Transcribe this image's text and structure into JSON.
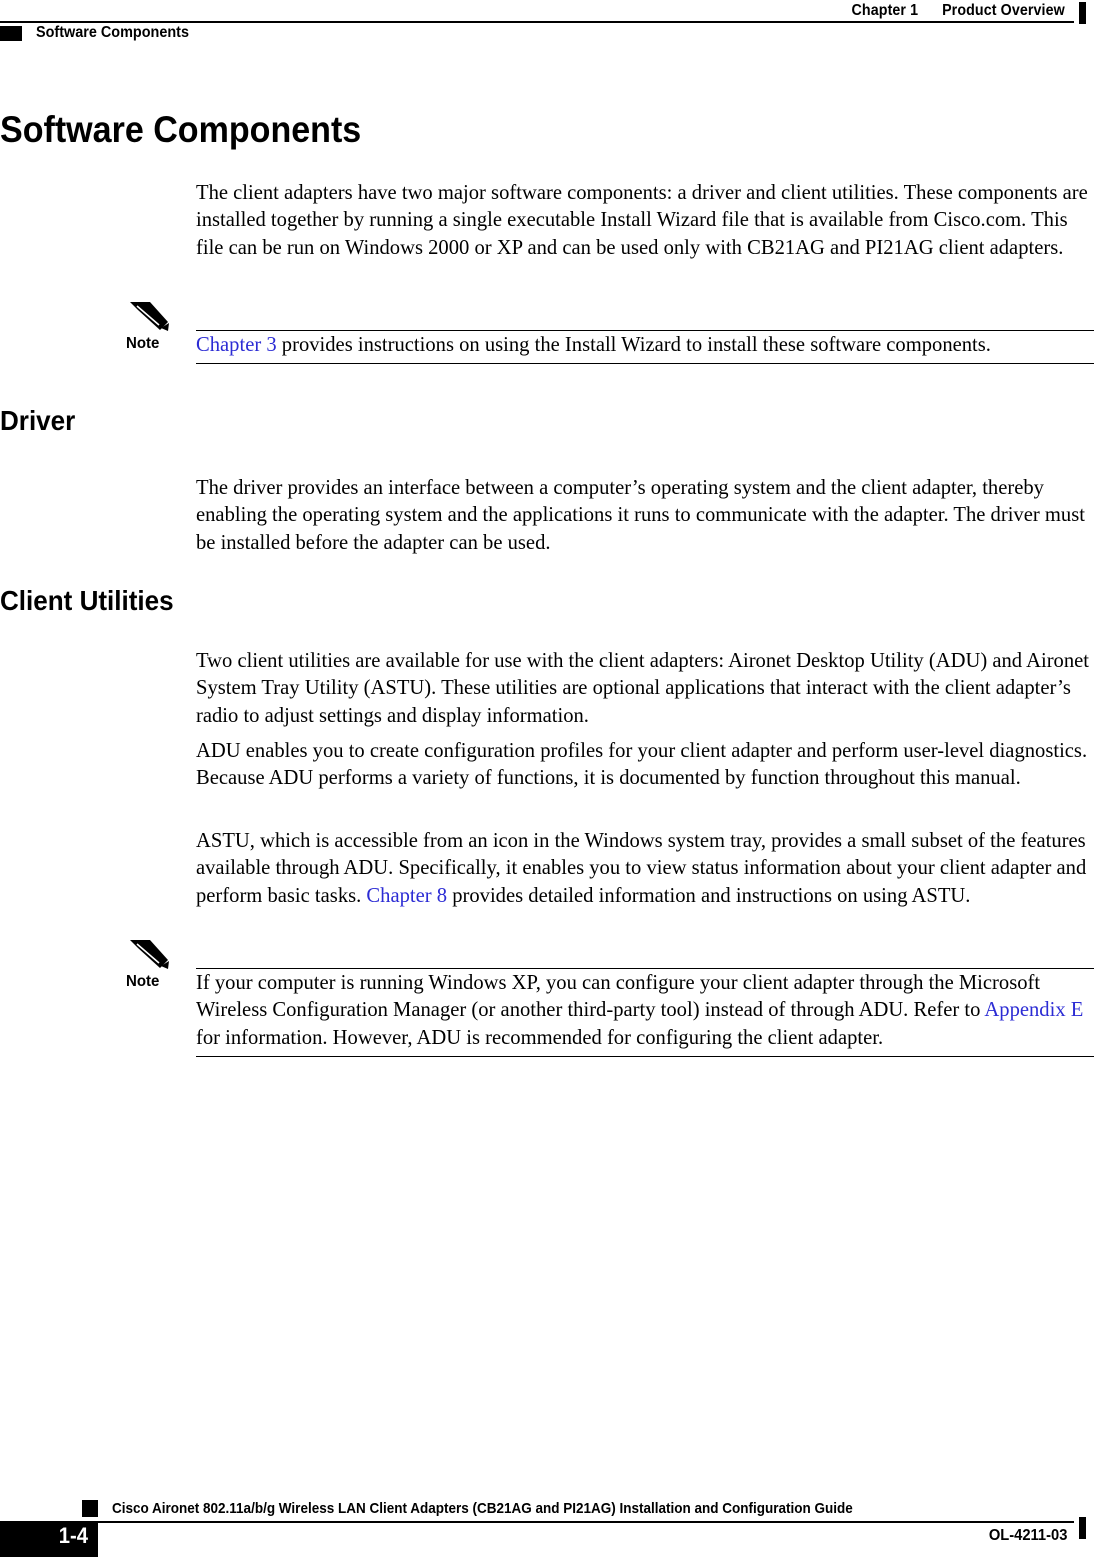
{
  "header": {
    "chapter_number": "Chapter 1",
    "chapter_title": "Product Overview",
    "section_title": "Software Components"
  },
  "main": {
    "h1_software_components": "Software Components",
    "para_intro": "The client adapters have two major software components: a driver and client utilities. These components are installed together by running a single executable Install Wizard file that is available from Cisco.com. This file can be run on Windows 2000 or XP and can be used only with CB21AG and PI21AG client adapters.",
    "note1": {
      "label": "Note",
      "xref": "Chapter 3",
      "text_after_xref": " provides instructions on using the Install Wizard to install these software components."
    },
    "h2_driver": "Driver",
    "para_driver": "The driver provides an interface between a computer’s operating system and the client adapter, thereby enabling the operating system and the applications it runs to communicate with the adapter. The driver must be installed before the adapter can be used.",
    "h2_client_utilities": "Client Utilities",
    "para_utilities_1": "Two client utilities are available for use with the client adapters: Aironet Desktop Utility (ADU) and Aironet System Tray Utility (ASTU). These utilities are optional applications that interact with the client adapter’s radio to adjust settings and display information.",
    "para_utilities_2": "ADU enables you to create configuration profiles for your client adapter and perform user-level diagnostics. Because ADU performs a variety of functions, it is documented by function throughout this manual.",
    "para_utilities_3_before_xref": "ASTU, which is accessible from an icon in the Windows system tray, provides a small subset of the features available through ADU. Specifically, it enables you to view status information about your client adapter and perform basic tasks. ",
    "para_utilities_3_xref": "Chapter 8",
    "para_utilities_3_after_xref": " provides detailed information and instructions on using ASTU.",
    "note2": {
      "label": "Note",
      "text_before_xref": "If your computer is running Windows XP, you can configure your client adapter through the Microsoft Wireless Configuration Manager (or another third-party tool) instead of through ADU. Refer to ",
      "xref": "Appendix E",
      "text_after_xref": " for information. However, ADU is recommended for configuring the client adapter."
    }
  },
  "footer": {
    "guide_title": "Cisco Aironet 802.11a/b/g Wireless LAN Client Adapters (CB21AG and PI21AG) Installation and Configuration Guide",
    "page_number": "1-4",
    "doc_id": "OL-4211-03"
  },
  "colors": {
    "text": "#000000",
    "cross_reference": "#2c2cd4",
    "rule": "#000000",
    "page_background": "#ffffff"
  }
}
